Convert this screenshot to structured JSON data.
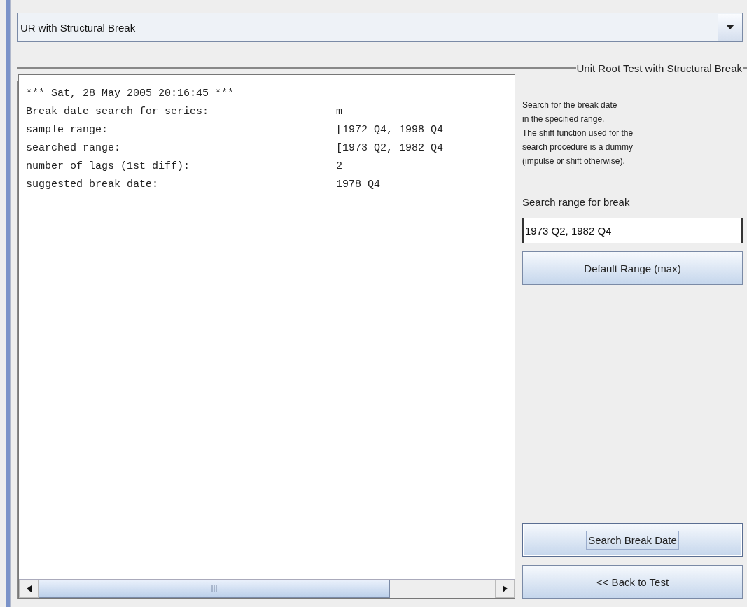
{
  "combo": {
    "value": "UR with Structural Break"
  },
  "group": {
    "title": "Unit Root Test with Structural Break"
  },
  "output": {
    "header": "*** Sat, 28 May 2005 20:16:45 ***",
    "rows": [
      {
        "label": "Break date search for series:",
        "value": "m"
      },
      {
        "label": "sample range:",
        "value": "[1972 Q4, 1998 Q4"
      },
      {
        "label": "searched range:",
        "value": "[1973 Q2, 1982 Q4"
      },
      {
        "label": "number of lags (1st diff):",
        "value": "2"
      },
      {
        "label": "suggested break date:",
        "value": "1978 Q4"
      }
    ]
  },
  "description": [
    "Search for the break date",
    "in the specified range.",
    "The shift function used for the",
    "search procedure is a dummy",
    "(impulse or shift otherwise)."
  ],
  "range": {
    "label": "Search range for break",
    "value": "1973 Q2, 1982 Q4"
  },
  "buttons": [
    {
      "label": "Default Range (max)",
      "focused": false
    },
    {
      "label": "Search Break Date",
      "focused": true
    },
    {
      "label": "<< Back to Test",
      "focused": false
    }
  ]
}
